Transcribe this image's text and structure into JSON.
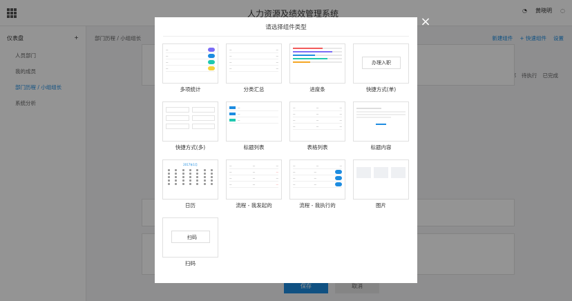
{
  "app": {
    "title": "人力资源及绩效管理系统",
    "user": "黄晓明"
  },
  "sidebar": {
    "title": "仪表盘",
    "add": "+",
    "items": [
      {
        "label": "人员部门"
      },
      {
        "label": "我的成员"
      },
      {
        "label": "部门历程 / 小组组长"
      },
      {
        "label": "系统分析"
      }
    ]
  },
  "content": {
    "breadcrumb": "部门历程 / 小组组长",
    "toolbar": [
      "新建组件",
      "+ 快速组件",
      "设置"
    ],
    "filters": [
      "全部",
      "待执行",
      "已完成"
    ]
  },
  "footer": {
    "save": "保存",
    "cancel": "取消"
  },
  "modal": {
    "title": "请选择组件类型",
    "close": "×",
    "cards": [
      {
        "label": "多项统计"
      },
      {
        "label": "分类汇总"
      },
      {
        "label": "进度条"
      },
      {
        "label": "快捷方式(单)",
        "button": "办理入职"
      },
      {
        "label": "快捷方式(多)"
      },
      {
        "label": "标题列表"
      },
      {
        "label": "表格列表"
      },
      {
        "label": "标题内容"
      },
      {
        "label": "日历",
        "month": "2017年1月"
      },
      {
        "label": "流程 - 我发起的"
      },
      {
        "label": "流程 - 我执行的"
      },
      {
        "label": "图片"
      },
      {
        "label": "扫码",
        "button": "扫码"
      }
    ]
  },
  "colors": {
    "accent": "#1d8ce0",
    "purple": "#7b6cf6",
    "teal": "#20c8b0",
    "yellow": "#f5d33a",
    "red": "#f25a5a"
  }
}
